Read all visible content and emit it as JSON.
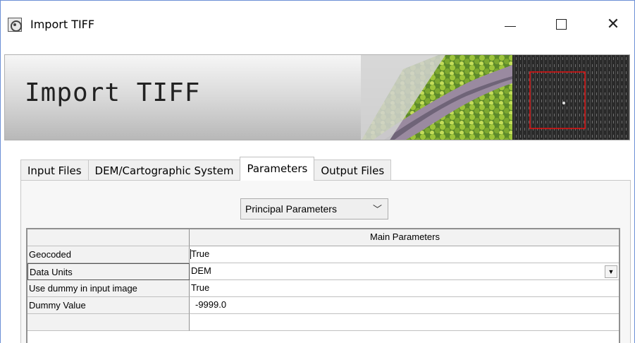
{
  "window": {
    "title": "Import TIFF",
    "minimize_glyph": "—",
    "close_glyph": "✕"
  },
  "banner": {
    "title": "Import TIFF"
  },
  "tabs": [
    {
      "label": "Input Files",
      "active": false
    },
    {
      "label": "DEM/Cartographic System",
      "active": false
    },
    {
      "label": "Parameters",
      "active": true
    },
    {
      "label": "Output Files",
      "active": false
    }
  ],
  "parameters": {
    "selector_value": "Principal Parameters",
    "table_header": "Main Parameters",
    "rows": [
      {
        "label": "Geocoded",
        "value": "True"
      },
      {
        "label": "Data Units",
        "value": "DEM"
      },
      {
        "label": "Use dummy in input image",
        "value": "True"
      },
      {
        "label": "Dummy Value",
        "value": "-9999.0"
      }
    ]
  },
  "icons": {
    "app": "app-globe-icon",
    "dropdown": "chevron-down-icon",
    "combo": "triangle-down-icon"
  }
}
